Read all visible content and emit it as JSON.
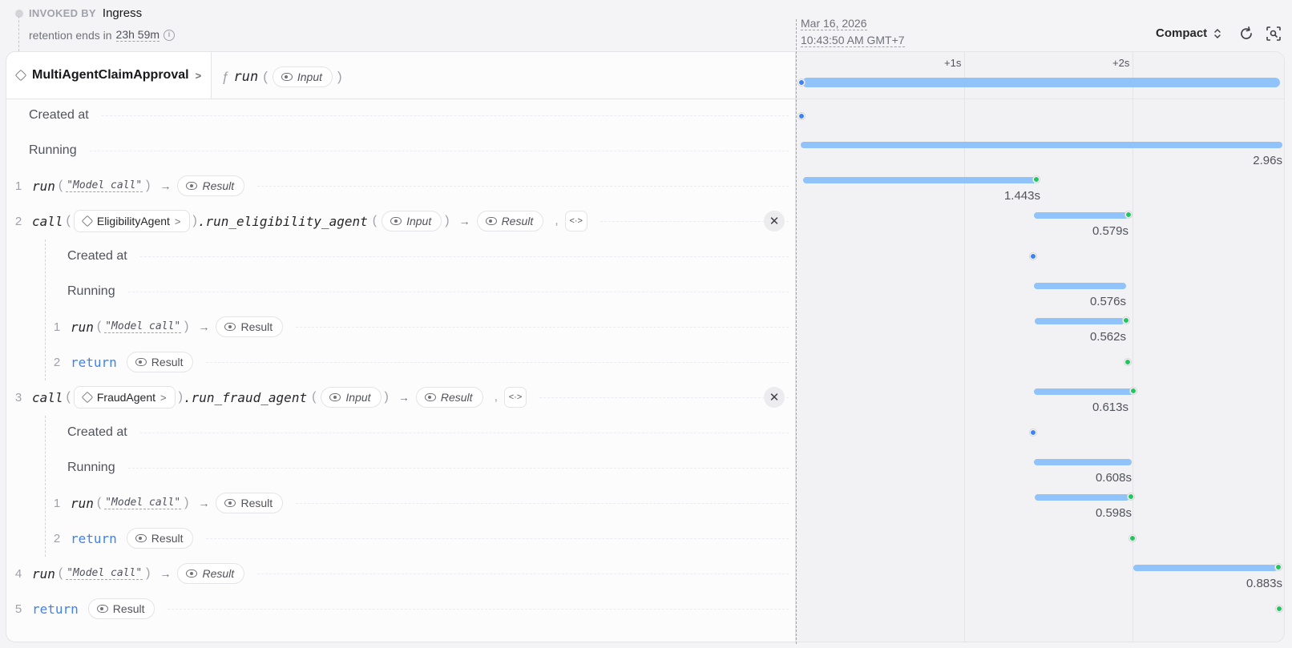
{
  "header": {
    "invoked_by_label": "INVOKED BY",
    "invoked_by_value": "Ingress",
    "retention_prefix": "retention ends in",
    "retention_duration": "23h 59m",
    "timestamp_date": "Mar 16, 2026",
    "timestamp_time": "10:43:50 AM GMT+7",
    "view_mode": "Compact"
  },
  "invocation": {
    "service": "MultiAgentClaimApproval",
    "handler": "run",
    "input_label": "Input"
  },
  "timeline": {
    "ticks": [
      "+1s",
      "+2s"
    ],
    "total_duration": "2.96s"
  },
  "rows": {
    "created_at": "Created at",
    "running": "Running",
    "running_duration": "2.96s",
    "step1": {
      "num": "1",
      "fn": "run",
      "arg": "\"Model call\"",
      "result": "Result",
      "duration": "1.443s"
    },
    "step2": {
      "num": "2",
      "kw": "call",
      "service": "EligibilityAgent",
      "method": ".run_eligibility_agent",
      "input": "Input",
      "result": "Result",
      "duration": "0.579s",
      "created_at": "Created at",
      "running": "Running",
      "running_duration": "0.576s",
      "sub1": {
        "num": "1",
        "fn": "run",
        "arg": "\"Model call\"",
        "result": "Result",
        "duration": "0.562s"
      },
      "sub2": {
        "num": "2",
        "kw": "return",
        "result": "Result"
      }
    },
    "step3": {
      "num": "3",
      "kw": "call",
      "service": "FraudAgent",
      "method": ".run_fraud_agent",
      "input": "Input",
      "result": "Result",
      "duration": "0.613s",
      "created_at": "Created at",
      "running": "Running",
      "running_duration": "0.608s",
      "sub1": {
        "num": "1",
        "fn": "run",
        "arg": "\"Model call\"",
        "result": "Result",
        "duration": "0.598s"
      },
      "sub2": {
        "num": "2",
        "kw": "return",
        "result": "Result"
      }
    },
    "step4": {
      "num": "4",
      "fn": "run",
      "arg": "\"Model call\"",
      "result": "Result",
      "duration": "0.883s"
    },
    "step5": {
      "num": "5",
      "kw": "return",
      "result": "Result"
    }
  },
  "colors": {
    "bar": "#8fc3f9",
    "accent_blue": "#3b82f6",
    "success_green": "#22c55e"
  }
}
